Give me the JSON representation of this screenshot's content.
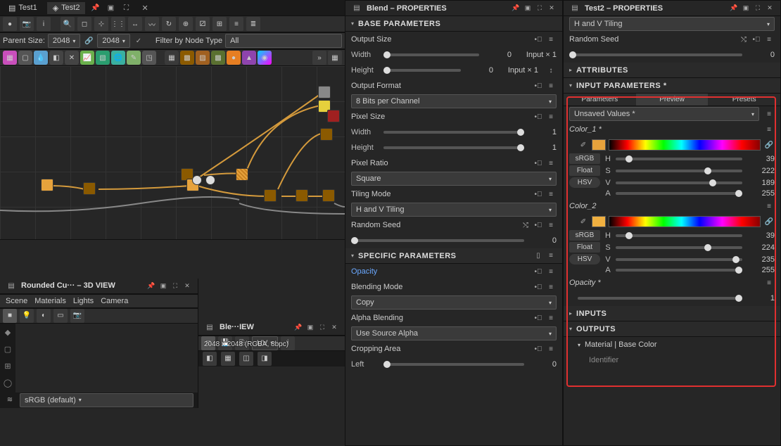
{
  "left": {
    "tabs": [
      "Test1",
      "Test2"
    ],
    "parent_size_label": "Parent Size:",
    "parent_size_values": [
      "2048",
      "2048"
    ],
    "filter_label": "Filter by Node Type",
    "filter_value": "All",
    "view3d_title": "Rounded Cu··· – 3D VIEW",
    "view3d_menu": [
      "Scene",
      "Materials",
      "Lights",
      "Camera"
    ],
    "view2d_title": "Ble···IEW",
    "view2d_uv": "UV",
    "view2d_overlay": "2048 x 2048 (RGBA, 8bpc)",
    "bottom_colorspace": "sRGB (default)"
  },
  "mid": {
    "title": "Blend – PROPERTIES",
    "base_params": "BASE PARAMETERS",
    "output_size": "Output Size",
    "width_lbl": "Width",
    "height_lbl": "Height",
    "zero": "0",
    "input_x1": "Input × 1",
    "output_format": "Output Format",
    "bpc": "8 Bits per Channel",
    "pixel_size": "Pixel Size",
    "one": "1",
    "pixel_ratio": "Pixel Ratio",
    "square": "Square",
    "tiling_mode": "Tiling Mode",
    "tiling_val": "H and V Tiling",
    "random_seed": "Random Seed",
    "specific_params": "SPECIFIC PARAMETERS",
    "opacity": "Opacity",
    "blending_mode": "Blending Mode",
    "blending_val": "Copy",
    "alpha_blending": "Alpha Blending",
    "alpha_val": "Use Source Alpha",
    "cropping_area": "Cropping Area",
    "left_lbl": "Left"
  },
  "right": {
    "title": "Test2 – PROPERTIES",
    "tiling_val": "H and V Tiling",
    "random_seed": "Random Seed",
    "zero": "0",
    "attributes": "ATTRIBUTES",
    "input_params": "INPUT PARAMETERS *",
    "tabs": [
      "Parameters",
      "Preview",
      "Presets"
    ],
    "unsaved": "Unsaved Values *",
    "color1": "Color_1 *",
    "color2": "Color_2",
    "srgb": "sRGB",
    "float": "Float",
    "hsv": "HSV",
    "h": "H",
    "s": "S",
    "v": "V",
    "a": "A",
    "c1": {
      "h": "39",
      "s": "222",
      "v": "189",
      "a": "255"
    },
    "c2": {
      "h": "39",
      "s": "224",
      "v": "235",
      "a": "255"
    },
    "opacity": "Opacity *",
    "one": "1",
    "inputs": "INPUTS",
    "outputs": "OUTPUTS",
    "output_sub": "Material | Base Color",
    "identifier": "Identifier"
  }
}
